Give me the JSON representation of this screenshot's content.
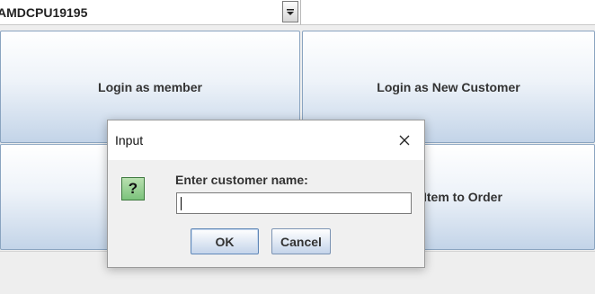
{
  "combo": {
    "selected_value": "AMDCPU19195"
  },
  "main_buttons": {
    "login_member": "Login as member",
    "login_new_customer": "Login as New Customer",
    "item_to_order": "Item to Order"
  },
  "dialog": {
    "title": "Input",
    "prompt": "Enter customer name:",
    "input_value": "",
    "ok_label": "OK",
    "cancel_label": "Cancel",
    "icon_glyph": "?",
    "icon_name": "question-icon"
  },
  "colors": {
    "button_gradient_top": "#ffffff",
    "button_gradient_bottom": "#c3d4e8",
    "question_icon_fill": "#7cc37c"
  }
}
